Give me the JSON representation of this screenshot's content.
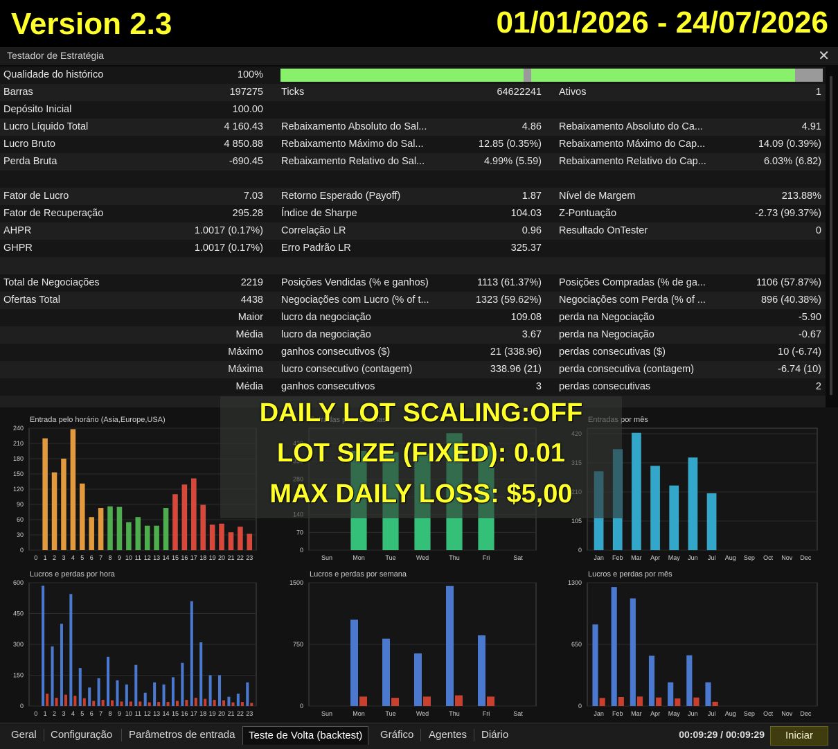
{
  "banner": {
    "version": "Version 2.3",
    "date_range": "01/01/2026 - 24/07/2026"
  },
  "window": {
    "title": "Testador de Estratégia",
    "close": "✕"
  },
  "stats": {
    "quality": {
      "label": "Qualidade do histórico",
      "value": "100%",
      "fill_fraction": 1.0
    },
    "rows": [
      {
        "alt": true,
        "c1": [
          "Barras",
          "197275"
        ],
        "c2": [
          "Ticks",
          "64622241"
        ],
        "c3": [
          "Ativos",
          "1"
        ]
      },
      {
        "alt": false,
        "c1": [
          "Depósito Inicial",
          "100.00"
        ],
        "c2": [
          "",
          ""
        ],
        "c3": [
          "",
          ""
        ]
      },
      {
        "alt": true,
        "c1": [
          "Lucro Líquido Total",
          "4 160.43"
        ],
        "c2": [
          "Rebaixamento Absoluto do Sal...",
          "4.86"
        ],
        "c3": [
          "Rebaixamento Absoluto do Ca...",
          "4.91"
        ]
      },
      {
        "alt": false,
        "c1": [
          "Lucro Bruto",
          "4 850.88"
        ],
        "c2": [
          "Rebaixamento Máximo do Sal...",
          "12.85 (0.35%)"
        ],
        "c3": [
          "Rebaixamento Máximo do Cap...",
          "14.09 (0.39%)"
        ]
      },
      {
        "alt": true,
        "c1": [
          "Perda Bruta",
          "-690.45"
        ],
        "c2": [
          "Rebaixamento Relativo do Sal...",
          "4.99% (5.59)"
        ],
        "c3": [
          "Rebaixamento Relativo do Cap...",
          "6.03% (6.82)"
        ]
      },
      {
        "alt": false,
        "c1": [
          "",
          ""
        ],
        "c2": [
          "",
          ""
        ],
        "c3": [
          "",
          ""
        ]
      },
      {
        "alt": true,
        "c1": [
          "Fator de Lucro",
          "7.03"
        ],
        "c2": [
          "Retorno Esperado (Payoff)",
          "1.87"
        ],
        "c3": [
          "Nível de Margem",
          "213.88%"
        ]
      },
      {
        "alt": false,
        "c1": [
          "Fator de Recuperação",
          "295.28"
        ],
        "c2": [
          "Índice de Sharpe",
          "104.03"
        ],
        "c3": [
          "Z-Pontuação",
          "-2.73 (99.37%)"
        ]
      },
      {
        "alt": true,
        "c1": [
          "AHPR",
          "1.0017 (0.17%)"
        ],
        "c2": [
          "Correlação LR",
          "0.96"
        ],
        "c3": [
          "Resultado OnTester",
          "0"
        ]
      },
      {
        "alt": false,
        "c1": [
          "GHPR",
          "1.0017 (0.17%)"
        ],
        "c2": [
          "Erro Padrão LR",
          "325.37"
        ],
        "c3": [
          "",
          ""
        ]
      },
      {
        "alt": true,
        "c1": [
          "",
          ""
        ],
        "c2": [
          "",
          ""
        ],
        "c3": [
          "",
          ""
        ]
      },
      {
        "alt": false,
        "c1": [
          "Total de Negociações",
          "2219"
        ],
        "c2": [
          "Posições Vendidas (% e ganhos)",
          "1113 (61.37%)"
        ],
        "c3": [
          "Posições Compradas (% de ga...",
          "1106 (57.87%)"
        ]
      },
      {
        "alt": true,
        "c1": [
          "Ofertas Total",
          "4438"
        ],
        "c2": [
          "Negociações com Lucro (% of t...",
          "1323 (59.62%)"
        ],
        "c3": [
          "Negociações com Perda (% of ...",
          "896 (40.38%)"
        ]
      },
      {
        "alt": false,
        "c1": [
          "",
          "Maior"
        ],
        "c2": [
          "lucro da negociação",
          "109.08"
        ],
        "c3": [
          "perda na Negociação",
          "-5.90"
        ]
      },
      {
        "alt": true,
        "c1": [
          "",
          "Média"
        ],
        "c2": [
          "lucro da negociação",
          "3.67"
        ],
        "c3": [
          "perda na Negociação",
          "-0.67"
        ]
      },
      {
        "alt": false,
        "c1": [
          "",
          "Máximo"
        ],
        "c2": [
          "ganhos consecutivos ($)",
          "21 (338.96)"
        ],
        "c3": [
          "perdas consecutivas ($)",
          "10 (-6.74)"
        ]
      },
      {
        "alt": true,
        "c1": [
          "",
          "Máxima"
        ],
        "c2": [
          "lucro consecutivo (contagem)",
          "338.96 (21)"
        ],
        "c3": [
          "perda consecutiva (contagem)",
          "-6.74 (10)"
        ]
      },
      {
        "alt": false,
        "c1": [
          "",
          "Média"
        ],
        "c2": [
          "ganhos consecutivos",
          "3"
        ],
        "c3": [
          "perdas consecutivas",
          "2"
        ]
      },
      {
        "alt": true,
        "c1": [
          "",
          ""
        ],
        "c2": [
          "",
          ""
        ],
        "c3": [
          "",
          ""
        ]
      }
    ]
  },
  "overlay": {
    "line1": "DAILY LOT SCALING:OFF",
    "line2": "LOT SIZE (FIXED): 0.01",
    "line3": "MAX DAILY LOSS: $5,00"
  },
  "colors": {
    "orange": "#e39a3c",
    "green": "#4cae4c",
    "red": "#d9473a",
    "blue": "#4a79cf",
    "teal": "#33a7c9",
    "seagreen": "#35c07a",
    "loss": "#c9402f"
  },
  "chart_data": [
    {
      "type": "bar",
      "title": "Entrada pelo horário (Asia,Europe,USA)",
      "categories": [
        "0",
        "1",
        "2",
        "3",
        "4",
        "5",
        "6",
        "7",
        "8",
        "9",
        "10",
        "11",
        "12",
        "13",
        "14",
        "15",
        "16",
        "17",
        "18",
        "19",
        "20",
        "21",
        "22",
        "23"
      ],
      "values": [
        0,
        220,
        153,
        180,
        238,
        131,
        65,
        83,
        86,
        85,
        55,
        65,
        48,
        48,
        83,
        110,
        129,
        141,
        89,
        50,
        52,
        35,
        46,
        32
      ],
      "groups": [
        "orange",
        "orange",
        "orange",
        "orange",
        "orange",
        "orange",
        "orange",
        "orange",
        "green",
        "green",
        "green",
        "green",
        "green",
        "green",
        "green",
        "red",
        "red",
        "red",
        "red",
        "red",
        "red",
        "red",
        "red",
        "red"
      ],
      "ylim": [
        0,
        240
      ],
      "yticks": [
        0,
        30,
        60,
        90,
        120,
        150,
        180,
        210,
        240
      ]
    },
    {
      "type": "bar",
      "title": "Entradas por semanas",
      "categories": [
        "Sun",
        "Mon",
        "Tue",
        "Wed",
        "Thu",
        "Fri",
        "Sat"
      ],
      "values": [
        0,
        390,
        385,
        380,
        460,
        410,
        0
      ],
      "ylim": [
        0,
        480
      ],
      "yticks": [
        0,
        70,
        140,
        210,
        280,
        350,
        420
      ]
    },
    {
      "type": "bar",
      "title": "Entradas por mês",
      "categories": [
        "Jan",
        "Feb",
        "Mar",
        "Apr",
        "May",
        "Jun",
        "Jul",
        "Aug",
        "Sep",
        "Oct",
        "Nov",
        "Dec"
      ],
      "values": [
        284,
        364,
        423,
        304,
        233,
        334,
        205,
        0,
        0,
        0,
        0,
        0
      ],
      "ylim": [
        0,
        440
      ],
      "yticks": [
        0,
        105,
        210,
        315,
        420
      ]
    },
    {
      "type": "bar",
      "title": "Lucros e perdas por hora",
      "categories": [
        "0",
        "1",
        "2",
        "3",
        "4",
        "5",
        "6",
        "7",
        "8",
        "9",
        "10",
        "11",
        "12",
        "13",
        "14",
        "15",
        "16",
        "17",
        "18",
        "19",
        "20",
        "21",
        "22",
        "23"
      ],
      "series": [
        {
          "name": "Lucros",
          "values": [
            0,
            585,
            290,
            400,
            545,
            185,
            90,
            135,
            240,
            125,
            105,
            200,
            65,
            115,
            105,
            140,
            210,
            510,
            310,
            150,
            150,
            45,
            60,
            115
          ]
        },
        {
          "name": "Perdas",
          "values": [
            0,
            60,
            40,
            55,
            50,
            38,
            25,
            30,
            28,
            22,
            22,
            22,
            18,
            20,
            20,
            25,
            30,
            40,
            35,
            30,
            28,
            18,
            20,
            15
          ]
        }
      ],
      "ylim": [
        0,
        600
      ],
      "yticks": [
        0,
        150,
        300,
        450,
        600
      ]
    },
    {
      "type": "bar",
      "title": "Lucros e perdas por semana",
      "categories": [
        "Sun",
        "Mon",
        "Tue",
        "Wed",
        "Thu",
        "Fri",
        "Sat"
      ],
      "series": [
        {
          "name": "Lucros",
          "values": [
            0,
            1050,
            820,
            640,
            1460,
            860,
            0
          ]
        },
        {
          "name": "Perdas",
          "values": [
            0,
            115,
            100,
            115,
            130,
            115,
            0
          ]
        }
      ],
      "ylim": [
        0,
        1500
      ],
      "yticks": [
        0,
        750,
        1500
      ]
    },
    {
      "type": "bar",
      "title": "Lucros e perdas por mês",
      "categories": [
        "Jan",
        "Feb",
        "Mar",
        "Apr",
        "May",
        "Jun",
        "Jul",
        "Aug",
        "Sep",
        "Oct",
        "Nov",
        "Dec"
      ],
      "series": [
        {
          "name": "Lucros",
          "values": [
            860,
            1255,
            1135,
            530,
            250,
            535,
            250,
            0,
            0,
            0,
            0,
            0
          ]
        },
        {
          "name": "Perdas",
          "values": [
            85,
            95,
            100,
            90,
            80,
            90,
            45,
            0,
            0,
            0,
            0,
            0
          ]
        }
      ],
      "ylim": [
        0,
        1300
      ],
      "yticks": [
        0,
        650,
        1300
      ]
    }
  ],
  "tabs": [
    "Geral",
    "Configuração",
    "Parâmetros de entrada",
    "Teste de Volta (backtest)",
    "Gráfico",
    "Agentes",
    "Diário"
  ],
  "active_tab": 3,
  "status": {
    "timer": "00:09:29 / 00:09:29",
    "start_label": "Iniciar"
  }
}
